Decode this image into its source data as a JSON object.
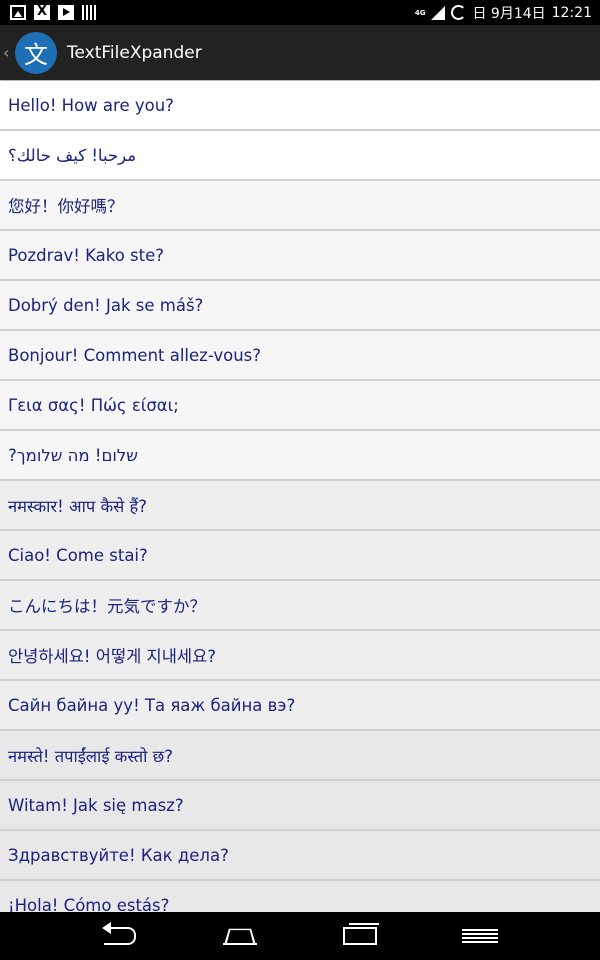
{
  "status_bar": {
    "network": "4G",
    "date": "日 9月14日",
    "time": "12:21",
    "icons": [
      "image-icon",
      "x-app-icon",
      "play-icon",
      "barcode-icon",
      "signal-icon",
      "sync-spinner-icon"
    ]
  },
  "action_bar": {
    "app_icon_glyph": "文",
    "title": "TextFileXpander"
  },
  "list": {
    "items": [
      {
        "text": "Hello! How are you?"
      },
      {
        "text": "مرحبا! كيف حالك؟"
      },
      {
        "text": "您好！你好嗎？"
      },
      {
        "text": "Pozdrav! Kako ste?"
      },
      {
        "text": "Dobrý den! Jak se máš?"
      },
      {
        "text": "Bonjour! Comment allez-vous?"
      },
      {
        "text": "Γεια σας! Πώς είσαι;"
      },
      {
        "text": "שלום! מה שלומך?"
      },
      {
        "text": "नमस्कार! आप कैसे हैं?"
      },
      {
        "text": "Ciao! Come stai?"
      },
      {
        "text": "こんにちは！元気ですか？"
      },
      {
        "text": "안녕하세요! 어떻게 지내세요?"
      },
      {
        "text": "Сайн байна уу! Та яаж байна вэ?"
      },
      {
        "text": "नमस्ते! तपाईंलाई कस्तो छ?"
      },
      {
        "text": "Witam! Jak się masz?"
      },
      {
        "text": "Здравствуйте! Как дела?"
      },
      {
        "text": "¡Hola! Cómo estás?"
      }
    ]
  },
  "colors": {
    "text": "#1a237e",
    "action_bar": "#222222",
    "app_icon": "#1e6fb5"
  },
  "nav_bar": {
    "icons": [
      "back-icon",
      "home-icon",
      "recent-apps-icon",
      "menu-icon"
    ]
  }
}
